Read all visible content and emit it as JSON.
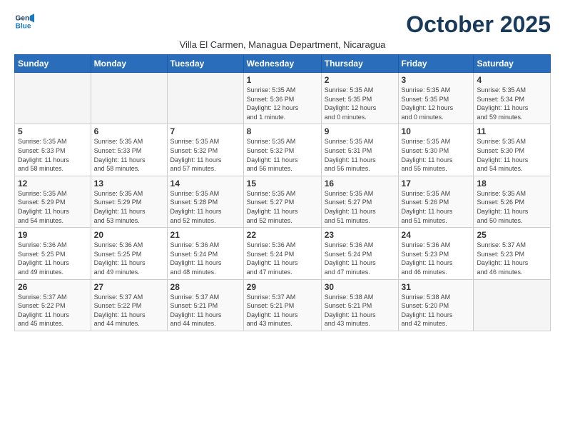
{
  "logo": {
    "line1": "General",
    "line2": "Blue"
  },
  "title": "October 2025",
  "subtitle": "Villa El Carmen, Managua Department, Nicaragua",
  "days_of_week": [
    "Sunday",
    "Monday",
    "Tuesday",
    "Wednesday",
    "Thursday",
    "Friday",
    "Saturday"
  ],
  "weeks": [
    [
      {
        "day": "",
        "content": ""
      },
      {
        "day": "",
        "content": ""
      },
      {
        "day": "",
        "content": ""
      },
      {
        "day": "1",
        "content": "Sunrise: 5:35 AM\nSunset: 5:36 PM\nDaylight: 12 hours\nand 1 minute."
      },
      {
        "day": "2",
        "content": "Sunrise: 5:35 AM\nSunset: 5:35 PM\nDaylight: 12 hours\nand 0 minutes."
      },
      {
        "day": "3",
        "content": "Sunrise: 5:35 AM\nSunset: 5:35 PM\nDaylight: 12 hours\nand 0 minutes."
      },
      {
        "day": "4",
        "content": "Sunrise: 5:35 AM\nSunset: 5:34 PM\nDaylight: 11 hours\nand 59 minutes."
      }
    ],
    [
      {
        "day": "5",
        "content": "Sunrise: 5:35 AM\nSunset: 5:33 PM\nDaylight: 11 hours\nand 58 minutes."
      },
      {
        "day": "6",
        "content": "Sunrise: 5:35 AM\nSunset: 5:33 PM\nDaylight: 11 hours\nand 58 minutes."
      },
      {
        "day": "7",
        "content": "Sunrise: 5:35 AM\nSunset: 5:32 PM\nDaylight: 11 hours\nand 57 minutes."
      },
      {
        "day": "8",
        "content": "Sunrise: 5:35 AM\nSunset: 5:32 PM\nDaylight: 11 hours\nand 56 minutes."
      },
      {
        "day": "9",
        "content": "Sunrise: 5:35 AM\nSunset: 5:31 PM\nDaylight: 11 hours\nand 56 minutes."
      },
      {
        "day": "10",
        "content": "Sunrise: 5:35 AM\nSunset: 5:30 PM\nDaylight: 11 hours\nand 55 minutes."
      },
      {
        "day": "11",
        "content": "Sunrise: 5:35 AM\nSunset: 5:30 PM\nDaylight: 11 hours\nand 54 minutes."
      }
    ],
    [
      {
        "day": "12",
        "content": "Sunrise: 5:35 AM\nSunset: 5:29 PM\nDaylight: 11 hours\nand 54 minutes."
      },
      {
        "day": "13",
        "content": "Sunrise: 5:35 AM\nSunset: 5:29 PM\nDaylight: 11 hours\nand 53 minutes."
      },
      {
        "day": "14",
        "content": "Sunrise: 5:35 AM\nSunset: 5:28 PM\nDaylight: 11 hours\nand 52 minutes."
      },
      {
        "day": "15",
        "content": "Sunrise: 5:35 AM\nSunset: 5:27 PM\nDaylight: 11 hours\nand 52 minutes."
      },
      {
        "day": "16",
        "content": "Sunrise: 5:35 AM\nSunset: 5:27 PM\nDaylight: 11 hours\nand 51 minutes."
      },
      {
        "day": "17",
        "content": "Sunrise: 5:35 AM\nSunset: 5:26 PM\nDaylight: 11 hours\nand 51 minutes."
      },
      {
        "day": "18",
        "content": "Sunrise: 5:35 AM\nSunset: 5:26 PM\nDaylight: 11 hours\nand 50 minutes."
      }
    ],
    [
      {
        "day": "19",
        "content": "Sunrise: 5:36 AM\nSunset: 5:25 PM\nDaylight: 11 hours\nand 49 minutes."
      },
      {
        "day": "20",
        "content": "Sunrise: 5:36 AM\nSunset: 5:25 PM\nDaylight: 11 hours\nand 49 minutes."
      },
      {
        "day": "21",
        "content": "Sunrise: 5:36 AM\nSunset: 5:24 PM\nDaylight: 11 hours\nand 48 minutes."
      },
      {
        "day": "22",
        "content": "Sunrise: 5:36 AM\nSunset: 5:24 PM\nDaylight: 11 hours\nand 47 minutes."
      },
      {
        "day": "23",
        "content": "Sunrise: 5:36 AM\nSunset: 5:24 PM\nDaylight: 11 hours\nand 47 minutes."
      },
      {
        "day": "24",
        "content": "Sunrise: 5:36 AM\nSunset: 5:23 PM\nDaylight: 11 hours\nand 46 minutes."
      },
      {
        "day": "25",
        "content": "Sunrise: 5:37 AM\nSunset: 5:23 PM\nDaylight: 11 hours\nand 46 minutes."
      }
    ],
    [
      {
        "day": "26",
        "content": "Sunrise: 5:37 AM\nSunset: 5:22 PM\nDaylight: 11 hours\nand 45 minutes."
      },
      {
        "day": "27",
        "content": "Sunrise: 5:37 AM\nSunset: 5:22 PM\nDaylight: 11 hours\nand 44 minutes."
      },
      {
        "day": "28",
        "content": "Sunrise: 5:37 AM\nSunset: 5:21 PM\nDaylight: 11 hours\nand 44 minutes."
      },
      {
        "day": "29",
        "content": "Sunrise: 5:37 AM\nSunset: 5:21 PM\nDaylight: 11 hours\nand 43 minutes."
      },
      {
        "day": "30",
        "content": "Sunrise: 5:38 AM\nSunset: 5:21 PM\nDaylight: 11 hours\nand 43 minutes."
      },
      {
        "day": "31",
        "content": "Sunrise: 5:38 AM\nSunset: 5:20 PM\nDaylight: 11 hours\nand 42 minutes."
      },
      {
        "day": "",
        "content": ""
      }
    ]
  ]
}
